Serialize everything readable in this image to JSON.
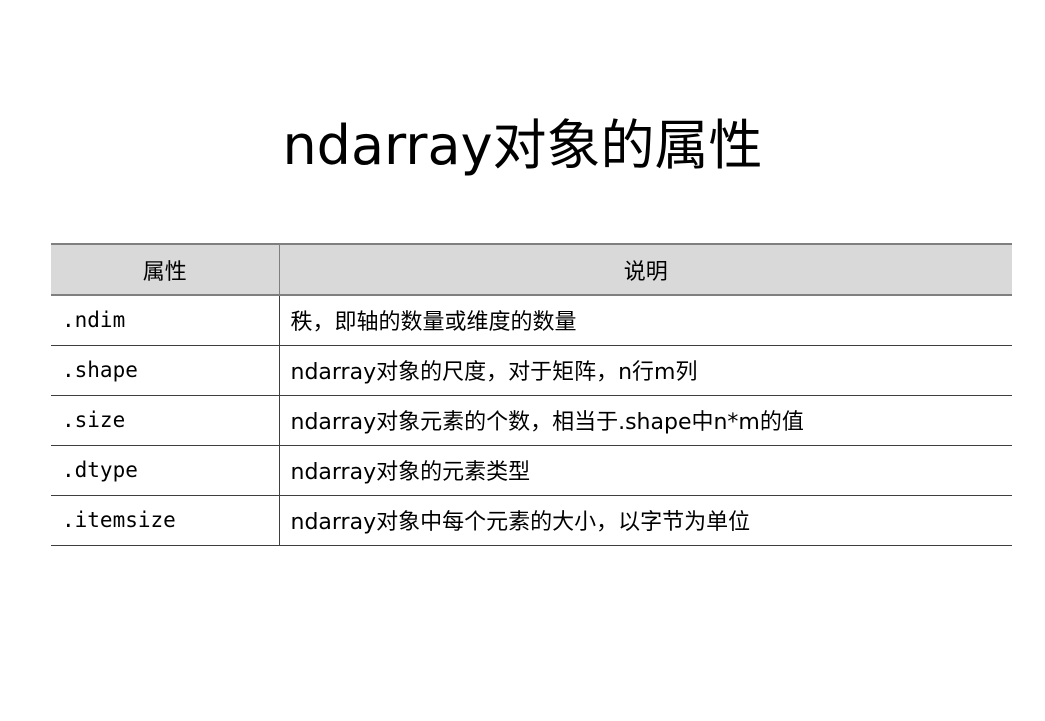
{
  "slide": {
    "title": "ndarray对象的属性"
  },
  "table": {
    "headers": [
      "属性",
      "说明"
    ],
    "rows": [
      {
        "property": ".ndim",
        "description": "秩，即轴的数量或维度的数量"
      },
      {
        "property": ".shape",
        "description": "ndarray对象的尺度，对于矩阵，n行m列"
      },
      {
        "property": ".size",
        "description": "ndarray对象元素的个数，相当于.shape中n*m的值"
      },
      {
        "property": ".dtype",
        "description": "ndarray对象的元素类型"
      },
      {
        "property": ".itemsize",
        "description": "ndarray对象中每个元素的大小，以字节为单位"
      }
    ]
  }
}
